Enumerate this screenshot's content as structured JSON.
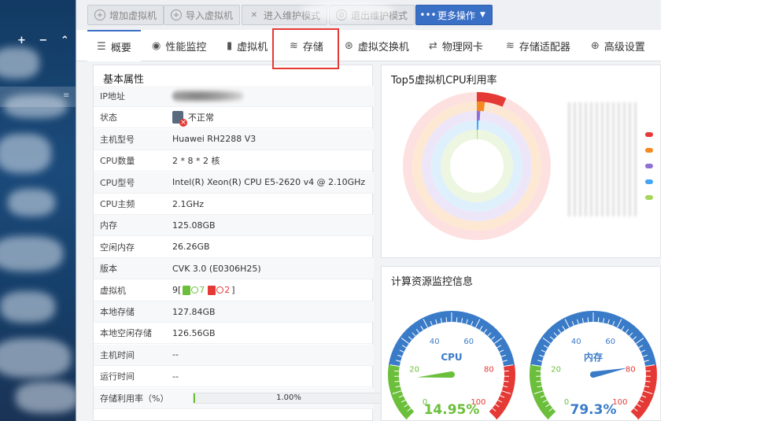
{
  "toolbar": {
    "buttons": [
      {
        "label": "增加虚拟机",
        "icon": "plus-circle-icon"
      },
      {
        "label": "导入虚拟机",
        "icon": "plus-circle-icon"
      },
      {
        "label": "进入维护模式",
        "icon": "wrench-icon"
      },
      {
        "label": "退出维护模式",
        "icon": "ban-icon"
      }
    ],
    "more_label": "更多操作"
  },
  "tabs": [
    {
      "label": "概要",
      "icon": "list-icon"
    },
    {
      "label": "性能监控",
      "icon": "monitor-icon"
    },
    {
      "label": "虚拟机",
      "icon": "vm-icon"
    },
    {
      "label": "存储",
      "icon": "database-icon"
    },
    {
      "label": "虚拟交换机",
      "icon": "switch-icon"
    },
    {
      "label": "物理网卡",
      "icon": "nic-icon"
    },
    {
      "label": "存储适配器",
      "icon": "database-icon"
    },
    {
      "label": "高级设置",
      "icon": "settings-icon"
    }
  ],
  "basic": {
    "title": "基本属性",
    "rows": [
      {
        "label": "IP地址",
        "value": ""
      },
      {
        "label": "状态",
        "value": "不正常"
      },
      {
        "label": "主机型号",
        "value": "Huawei RH2288 V3"
      },
      {
        "label": "CPU数量",
        "value": "2 * 8 * 2 核"
      },
      {
        "label": "CPU型号",
        "value": "Intel(R) Xeon(R) CPU E5-2620 v4 @ 2.10GHz"
      },
      {
        "label": "CPU主频",
        "value": "2.1GHz"
      },
      {
        "label": "内存",
        "value": "125.08GB"
      },
      {
        "label": "空闲内存",
        "value": "26.26GB"
      },
      {
        "label": "版本",
        "value": "CVK 3.0 (E0306H25)"
      },
      {
        "label": "虚拟机",
        "value": ""
      },
      {
        "label": "本地存储",
        "value": "127.84GB"
      },
      {
        "label": "本地空闲存储",
        "value": "126.56GB"
      },
      {
        "label": "主机时间",
        "value": "--"
      },
      {
        "label": "运行时间",
        "value": "--"
      },
      {
        "label": "存储利用率（%）",
        "value": ""
      }
    ],
    "vm_total": "9",
    "vm_open": "[",
    "vm_running": "7",
    "vm_stopped": "2",
    "vm_close": "]",
    "storage_usage": 1.0,
    "storage_usage_text": "1.00%"
  },
  "top5": {
    "title": "Top5虚拟机CPU利用率",
    "ring_colors": [
      "#e53935",
      "#f6891f",
      "#8e6fd6",
      "#42a5f5",
      "#a5d65a"
    ],
    "ring_values": [
      0.065,
      0.02,
      0.01,
      0.006,
      0.003
    ]
  },
  "monitor": {
    "title": "计算资源监控信息",
    "gauges": [
      {
        "label": "CPU",
        "value": 14.95,
        "value_text": "14.95%",
        "color": "#6bbf3b",
        "ticks": [
          "0",
          "20",
          "40",
          "60",
          "80",
          "100"
        ]
      },
      {
        "label": "内存",
        "value": 79.3,
        "value_text": "79.3%",
        "color": "#3a7bc8",
        "ticks": [
          "0",
          "20",
          "40",
          "60",
          "80",
          "100"
        ]
      }
    ]
  }
}
